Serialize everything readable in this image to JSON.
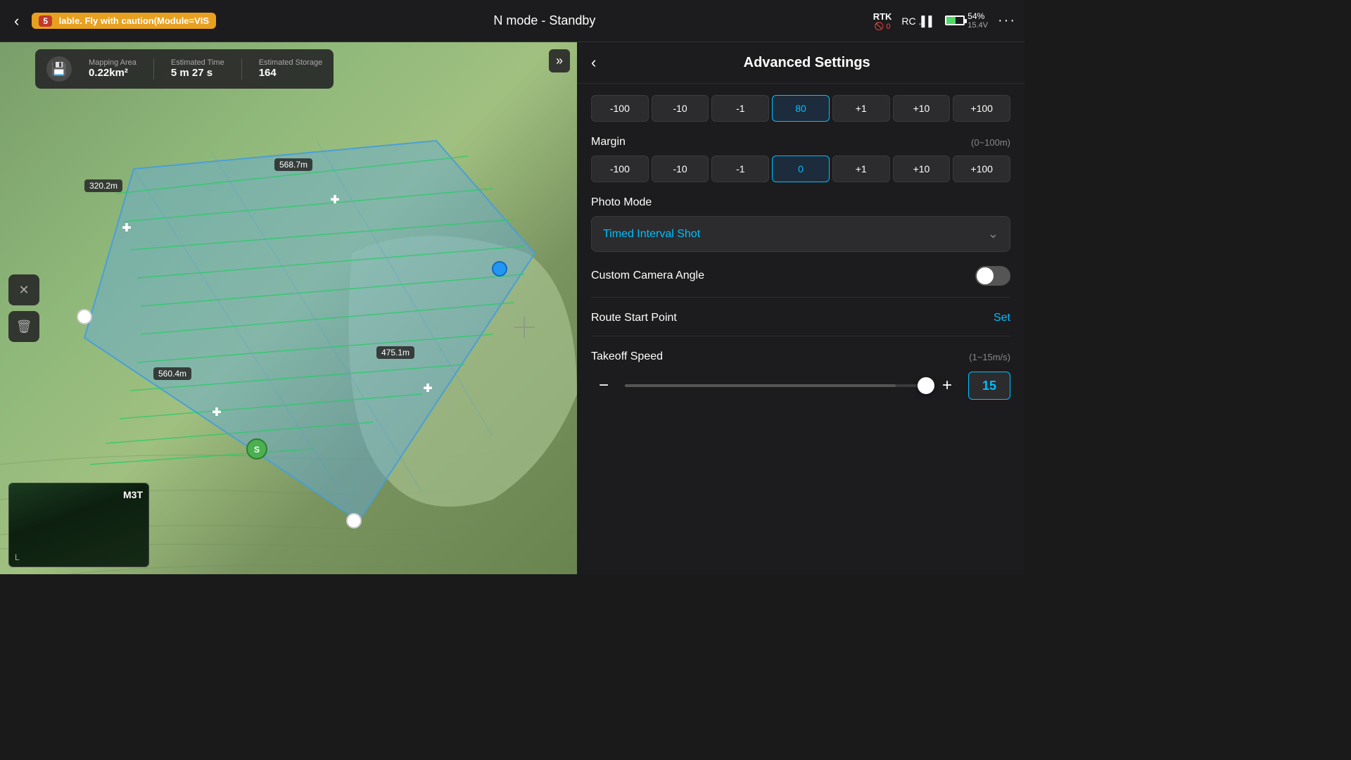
{
  "topBar": {
    "backLabel": "‹",
    "notification": "lable. Fly with caution(Module=VIS",
    "notificationCount": "5",
    "flightMode": "N mode - Standby",
    "rtk": {
      "label": "RTK",
      "sub": "🚫 0"
    },
    "rc": "RC .▌▌",
    "battery": {
      "percent": "54%",
      "voltage": "15.4V"
    },
    "moreLabel": "···"
  },
  "mapInfo": {
    "saveIcon": "💾",
    "mappingArea": {
      "label": "Mapping Area",
      "value": "0.22km²"
    },
    "estimatedTime": {
      "label": "Estimated Time",
      "value": "5 m 27 s"
    },
    "estimatedStorage": {
      "label": "Estimated Storage",
      "value": "164"
    },
    "expandIcon": "»"
  },
  "distanceLabels": [
    {
      "text": "568.7m",
      "top": "165",
      "left": "400"
    },
    {
      "text": "320.2m",
      "top": "195",
      "left": "125"
    },
    {
      "text": "475.1m",
      "top": "430",
      "left": "540"
    },
    {
      "text": "560.4m",
      "top": "460",
      "left": "230"
    }
  ],
  "toolbar": {
    "closeIcon": "✕",
    "trashIcon": "🗑"
  },
  "cameraPreview": {
    "label": "M3T",
    "corner": "L"
  },
  "settings": {
    "backLabel": "‹",
    "title": "Advanced Settings",
    "altitude": {
      "buttons": [
        "-100",
        "-10",
        "-1",
        "80",
        "+1",
        "+10",
        "+100"
      ]
    },
    "margin": {
      "label": "Margin",
      "hint": "(0~100m)",
      "buttons": [
        "-100",
        "-10",
        "-1",
        "0",
        "+1",
        "+10",
        "+100"
      ]
    },
    "photoMode": {
      "label": "Photo Mode",
      "value": "Timed Interval Shot",
      "arrowIcon": "⌄"
    },
    "customCameraAngle": {
      "label": "Custom Camera Angle",
      "enabled": false
    },
    "routeStartPoint": {
      "label": "Route Start Point",
      "actionLabel": "Set"
    },
    "takeoffSpeed": {
      "label": "Takeoff Speed",
      "hint": "(1~15m/s)",
      "minusIcon": "−",
      "plusIcon": "+",
      "value": "15",
      "sliderPercent": 90
    }
  },
  "colors": {
    "accent": "#00bfff",
    "warning": "#e8a020",
    "success": "#4caf50"
  }
}
